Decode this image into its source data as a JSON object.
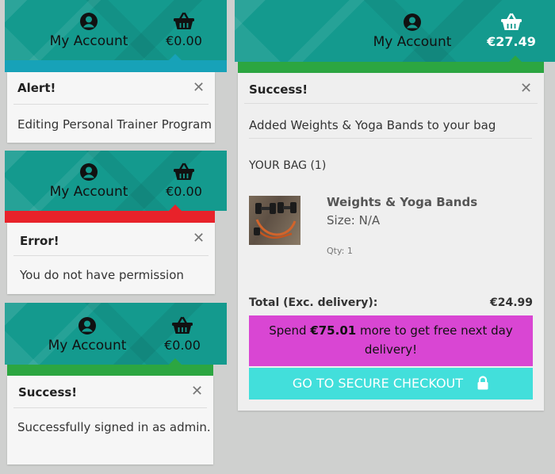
{
  "panel_alert": {
    "account_label": "My Account",
    "bag_total": "€0.00",
    "accent_color": "#17a2b8",
    "title": "Alert!",
    "close": "✕",
    "message": "Editing Personal Trainer Program"
  },
  "panel_error": {
    "account_label": "My Account",
    "bag_total": "€0.00",
    "accent_color": "#e8222a",
    "title": "Error!",
    "close": "✕",
    "message": "You do not have permission"
  },
  "panel_success_admin": {
    "account_label": "My Account",
    "bag_total": "€0.00",
    "accent_color": "#2ca641",
    "title": "Success!",
    "close": "✕",
    "message": "Successfully signed in as admin."
  },
  "panel_bag": {
    "account_label": "My Account",
    "bag_total": "€27.49",
    "accent_color": "#2ca641",
    "title": "Success!",
    "close": "✕",
    "message": "Added Weights & Yoga Bands to your bag",
    "bag_heading": "YOUR BAG (1)",
    "item": {
      "name": "Weights & Yoga Bands",
      "size": "Size: N/A",
      "qty": "Qty: 1",
      "image": "dumbbells-and-bands-photo"
    },
    "total_label": "Total (Exc. delivery):",
    "total_value": "€24.99",
    "delivery_prefix": "Spend ",
    "delivery_amount": "€75.01",
    "delivery_line1_suffix": " more to get free next day",
    "delivery_line2": "delivery!",
    "delivery_color": "#d946d3",
    "checkout_label": "GO TO SECURE CHECKOUT",
    "checkout_color": "#42dfdb"
  },
  "icons": {
    "account": "user-circle-icon",
    "bag": "shopping-basket-icon",
    "close": "close-icon",
    "lock": "lock-icon"
  }
}
